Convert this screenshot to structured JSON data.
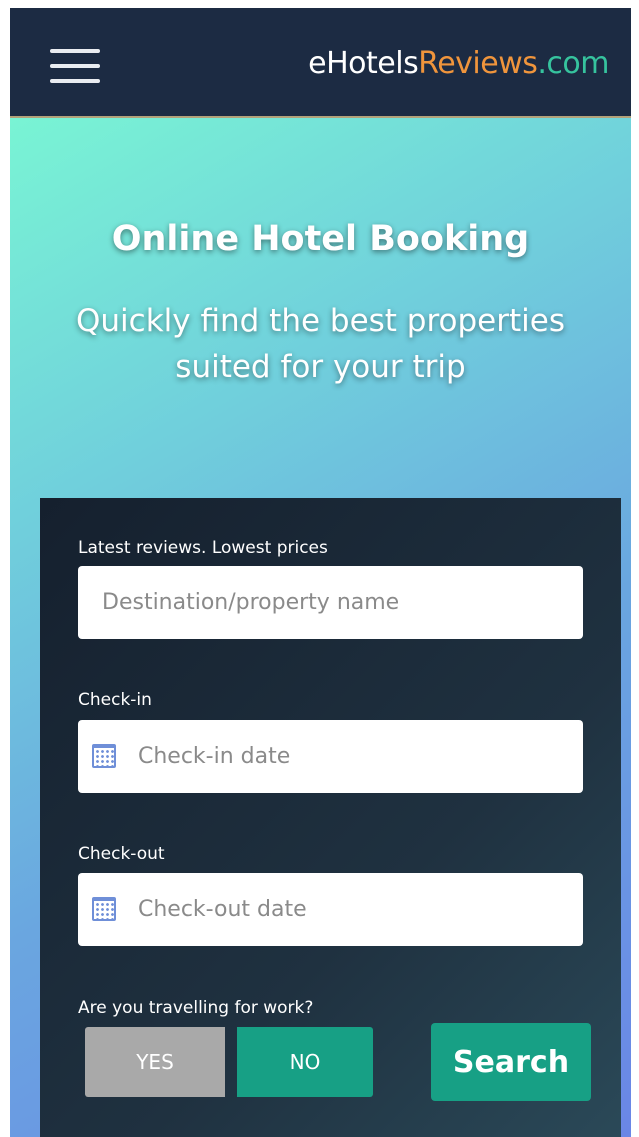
{
  "navbar": {
    "menu_icon": "hamburger-menu-icon",
    "brand": {
      "part1": "eHotels",
      "part2": "Reviews",
      "part3": ".com"
    }
  },
  "hero": {
    "title": "Online Hotel Booking",
    "subtitle": "Quickly find the best properties suited for your trip"
  },
  "form": {
    "destination_label": "Latest reviews. Lowest prices",
    "destination_placeholder": "Destination/property name",
    "checkin_label": "Check-in",
    "checkin_placeholder": "Check-in date",
    "checkout_label": "Check-out",
    "checkout_placeholder": "Check-out date",
    "calendar_icon": "calendar-icon",
    "work_question": "Are you travelling for work?",
    "yes_label": "YES",
    "no_label": "NO",
    "search_label": "Search"
  },
  "colors": {
    "navbar_bg": "#1c2b43",
    "brand_orange": "#f0953c",
    "brand_green": "#36c39e",
    "accent_green": "#17a085",
    "toggle_inactive": "#a9a9a9",
    "panel_bg": "#1b2a38"
  }
}
